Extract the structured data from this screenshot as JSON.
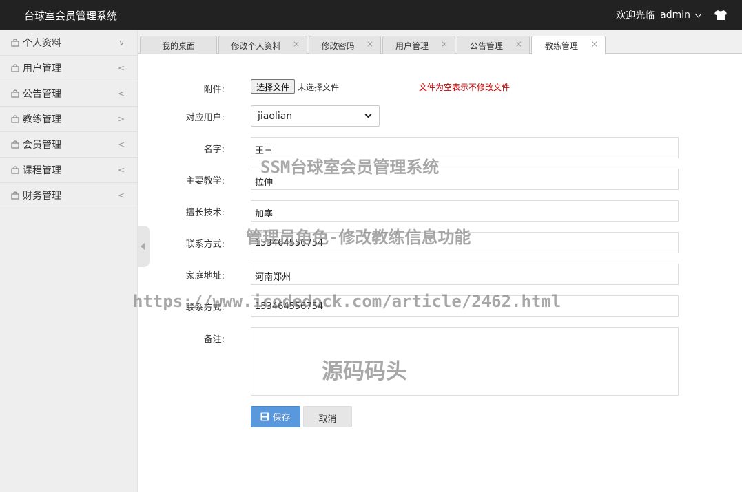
{
  "header": {
    "title": "台球室会员管理系统",
    "welcome": "欢迎光临",
    "user": "admin"
  },
  "sidebar": {
    "items": [
      {
        "label": "个人资料",
        "arrow": "∨"
      },
      {
        "label": "用户管理",
        "arrow": "<"
      },
      {
        "label": "公告管理",
        "arrow": "<"
      },
      {
        "label": "教练管理",
        "arrow": ">"
      },
      {
        "label": "会员管理",
        "arrow": "<"
      },
      {
        "label": "课程管理",
        "arrow": "<"
      },
      {
        "label": "财务管理",
        "arrow": "<"
      }
    ]
  },
  "tabs": [
    {
      "label": "我的桌面"
    },
    {
      "label": "修改个人资料",
      "close": "×"
    },
    {
      "label": "修改密码",
      "close": "×"
    },
    {
      "label": "用户管理",
      "close": "×"
    },
    {
      "label": "公告管理",
      "close": "×"
    },
    {
      "label": "教练管理",
      "close": "×"
    }
  ],
  "form": {
    "attachment_label": "附件:",
    "file_button": "选择文件",
    "file_none": "未选择文件",
    "file_note": "文件为空表示不修改文件",
    "user_label": "对应用户:",
    "user_value": "jiaolian",
    "name_label": "名字:",
    "name_value": "王三",
    "teaching_label": "主要教学:",
    "teaching_value": "拉伸",
    "skill_label": "擅长技术:",
    "skill_value": "加塞",
    "contact_label": "联系方式:",
    "contact_value": "153464556754",
    "address_label": "家庭地址:",
    "address_value": "河南郑州",
    "contact2_label": "联系方式:",
    "contact2_value": "153464556754",
    "remark_label": "备注:",
    "save": "保存",
    "cancel": "取消"
  },
  "watermarks": {
    "line1": "SSM台球室会员管理系统",
    "line2": "管理员角色-修改教练信息功能",
    "line3": "https://www.icodedock.com/article/2462.html",
    "line4": "源码码头"
  },
  "colors": {
    "header_bg": "#222222",
    "save_button": "#5a98de",
    "note_red": "#cc0000"
  }
}
